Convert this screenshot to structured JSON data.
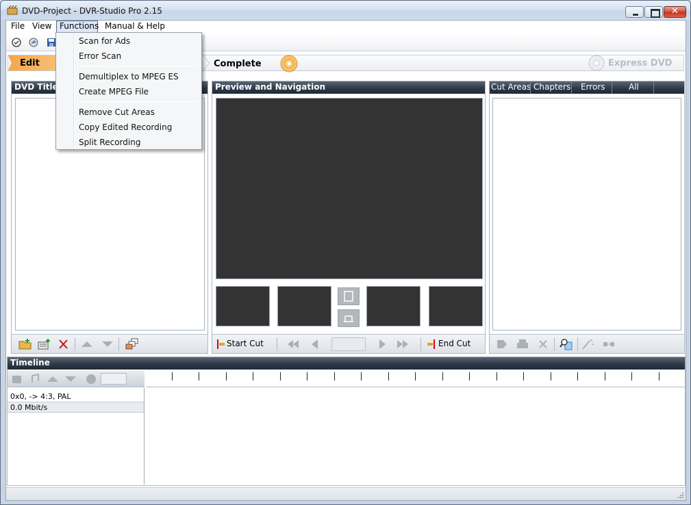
{
  "window": {
    "title": "DVD-Project - DVR-Studio Pro 2.15"
  },
  "menubar": {
    "file": "File",
    "view": "View",
    "functions": "Functions",
    "manual": "Manual & Help"
  },
  "functions_menu": {
    "items": [
      "Scan for Ads",
      "Error Scan",
      "Demultiplex to MPEG ES",
      "Create MPEG File",
      "Remove Cut Areas",
      "Copy Edited Recording",
      "Split Recording"
    ]
  },
  "steps": {
    "edit": "Edit",
    "complete": "Complete",
    "express": "Express DVD"
  },
  "panels": {
    "titles": "DVD Titles",
    "preview": "Preview and Navigation",
    "timeline": "Timeline"
  },
  "cut_tabs": [
    "Cut Areas",
    "Chapters",
    "Errors",
    "All"
  ],
  "preview_footer": {
    "start_cut": "Start Cut",
    "end_cut": "End Cut"
  },
  "timeline_info": {
    "format": "0x0,  -> 4:3, PAL",
    "bitrate": "0.0 Mbit/s"
  },
  "colors": {
    "edit_step": "#f4a64a",
    "panel_header": "#2e3a48",
    "preview_bg": "#333333",
    "close_button": "#c4351d",
    "delete_icon": "#cc1111"
  }
}
